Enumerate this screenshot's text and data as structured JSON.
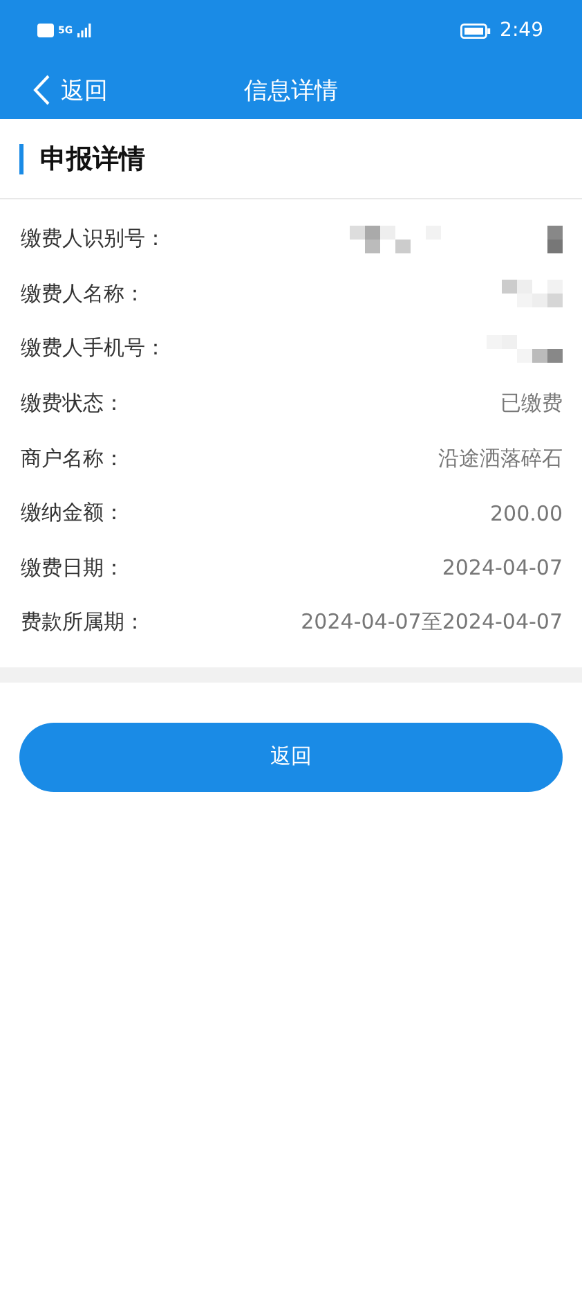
{
  "status_bar": {
    "network": "5G",
    "time": "2:49"
  },
  "nav": {
    "back_label": "返回",
    "title": "信息详情"
  },
  "section": {
    "title": "申报详情"
  },
  "fields": [
    {
      "label": "缴费人识别号：",
      "kind": "masked"
    },
    {
      "label": "缴费人名称：",
      "kind": "masked"
    },
    {
      "label": "缴费人手机号：",
      "kind": "masked"
    },
    {
      "label": "缴费状态：",
      "kind": "text",
      "value": "已缴费"
    },
    {
      "label": "商户名称：",
      "kind": "text",
      "value": "沿途洒落碎石"
    },
    {
      "label": "缴纳金额：",
      "kind": "text",
      "value": "200.00"
    },
    {
      "label": "缴费日期：",
      "kind": "text",
      "value": "2024-04-07"
    },
    {
      "label": "费款所属期：",
      "kind": "text",
      "value": "2024-04-07至2024-04-07"
    }
  ],
  "button": {
    "label": "返回"
  }
}
